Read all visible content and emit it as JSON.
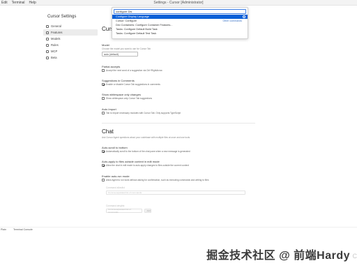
{
  "window": {
    "menus": [
      "Edit",
      "Terminal",
      "Help"
    ],
    "title": "Settings - Cursor [Administrator]"
  },
  "settings": {
    "title": "Cursor Settings",
    "sidebar": [
      {
        "label": "General",
        "icon": "gear-icon"
      },
      {
        "label": "Features",
        "icon": "features-icon",
        "active": true
      },
      {
        "label": "Models",
        "icon": "models-icon"
      },
      {
        "label": "Rules",
        "icon": "rules-icon"
      },
      {
        "label": "MCP",
        "icon": "mcp-icon"
      },
      {
        "label": "Beta",
        "icon": "beta-icon"
      }
    ]
  },
  "palette": {
    "input_value": "configure Dis",
    "items": [
      {
        "label": "Configure Display Language",
        "selected": true
      },
      {
        "label": "Cursor: Configure",
        "right": "Other commands"
      },
      {
        "label": "Dev Containers: Configure Container Features..."
      },
      {
        "label": "Tasks: Configure Default Build Task"
      },
      {
        "label": "Tasks: Configure Default Test Task"
      }
    ]
  },
  "tab": {
    "section_title": "Curso",
    "model_title": "Model",
    "model_desc": "Choose the model you want to use for Cursor Tab",
    "model_value": "auto (default)",
    "partial_title": "Partial accepts",
    "partial_desc": "Accept the next word of a suggestion via Ctrl+RightArrow",
    "comments_title": "Suggestions in Comments",
    "comments_desc": "Enable or disable Cursor Tab suggestions in comments",
    "whitespace_title": "Show whitespace only changes",
    "whitespace_desc": "Show whitespace-only Cursor Tab suggestions",
    "import_title": "Auto Import",
    "import_desc": "Tab to import necessary modules with Cursor Tab. Only supports TypeScript"
  },
  "chat": {
    "section_title": "Chat",
    "section_desc": "Ask Cursor Agent questions about your codebase with multiple files at once and use tools",
    "autoscroll_title": "Auto-scroll to bottom",
    "autoscroll_desc": "Automatically scroll to the bottom of the chat pane when a new message is generated",
    "autoapply_title": "Auto-apply to files outside context in edit mode",
    "autoapply_desc": "Allow the chat in edit mode to auto-apply changes to files outside the current context",
    "autorun_title": "Enable auto-run mode",
    "autorun_desc": "Allow Agent to run tools without asking for confirmation, such as executing commands and writing to files",
    "allowlist_label": "Command allowlist",
    "allowlist_placeholder": "Comma-separated list of commands",
    "denylist_label": "Command denylist",
    "denylist_placeholder": "Comma-separated list of commands",
    "add_button": "Add"
  },
  "statusbar": {
    "left": "Plain",
    "right": "Terminal Console"
  },
  "watermark": {
    "text": "掘金技术社区 @ 前端Hardy",
    "corner": "C"
  }
}
